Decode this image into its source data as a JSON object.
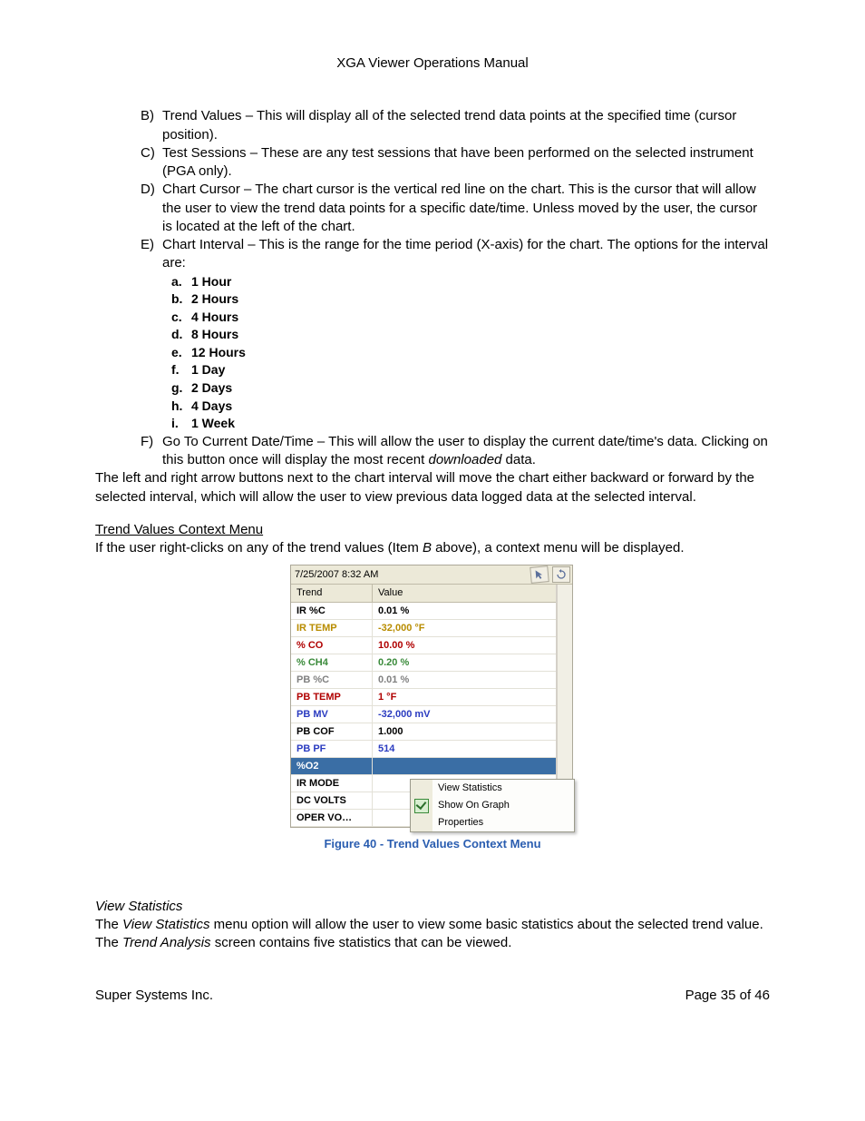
{
  "page_title": "XGA Viewer Operations Manual",
  "list": {
    "B": "Trend Values – This will display all of the selected trend data points at the specified time (cursor position).",
    "C": "Test Sessions – These are any test sessions that have been performed on the selected instrument (PGA only).",
    "D": "Chart Cursor – The chart cursor is the vertical red line on the chart.  This is the cursor that will allow the user to view the trend data points for a specific date/time.  Unless moved by the user, the cursor is located at the left of the chart.",
    "E": "Chart Interval – This is the range for the time period (X-axis) for the chart.  The options for the interval are:",
    "F_pre": "Go To Current Date/Time – This will allow the user to display the current date/time's data.  Clicking on this button once will display the most recent ",
    "F_em": "downloaded",
    "F_post": " data."
  },
  "sub_items": {
    "a": "1 Hour",
    "b": "2 Hours",
    "c": "4 Hours",
    "d": "8 Hours",
    "e": "12 Hours",
    "f": "1 Day",
    "g": "2 Days",
    "h": "4 Days",
    "i": "1 Week"
  },
  "after_list": "The left and right arrow buttons next to the chart interval will move the chart either backward or forward by the selected interval, which will allow the user to view previous data logged data at the selected interval.",
  "tv_heading": "Trend Values Context Menu",
  "tv_intro_1": "If the user right-clicks on any of the trend values (Item ",
  "tv_intro_B": "B",
  "tv_intro_2": " above), a context menu will be displayed.",
  "panel": {
    "timestamp": "7/25/2007 8:32 AM",
    "col1": "Trend",
    "col2": "Value",
    "rows": [
      {
        "name": "IR %C",
        "val": "0.01 %",
        "c": "#000000"
      },
      {
        "name": "IR TEMP",
        "val": "-32,000 °F",
        "c": "#b88c00"
      },
      {
        "name": "% CO",
        "val": "10.00 %",
        "c": "#b00000"
      },
      {
        "name": "% CH4",
        "val": "0.20 %",
        "c": "#3a8a3a"
      },
      {
        "name": "PB %C",
        "val": "0.01 %",
        "c": "#808080"
      },
      {
        "name": "PB TEMP",
        "val": "1 °F",
        "c": "#b00000"
      },
      {
        "name": "PB MV",
        "val": "-32,000 mV",
        "c": "#2a3bc0"
      },
      {
        "name": "PB COF",
        "val": "1.000",
        "c": "#000000"
      },
      {
        "name": "PB PF",
        "val": "514",
        "c": "#2a3bc0"
      },
      {
        "name": "%O2",
        "val": "",
        "c": "#ffffff",
        "sel": true
      },
      {
        "name": "IR MODE",
        "val": "",
        "c": "#000000"
      },
      {
        "name": "DC VOLTS",
        "val": "",
        "c": "#000000"
      },
      {
        "name": "OPER VO…",
        "val": "",
        "c": "#000000"
      }
    ],
    "menu": {
      "m1": "View Statistics",
      "m2": "Show On Graph",
      "m3": "Properties"
    }
  },
  "figure_caption": "Figure 40 - Trend Values Context Menu",
  "vs_head": "View Statistics",
  "vs_p1_a": "The ",
  "vs_p1_em": "View Statistics",
  "vs_p1_b": " menu option will allow the user to view some basic statistics about the selected trend value.",
  "vs_p2_a": "The ",
  "vs_p2_em": "Trend Analysis",
  "vs_p2_b": " screen contains five statistics that can be viewed.",
  "footer": {
    "left": "Super Systems Inc.",
    "right": "Page 35 of 46"
  }
}
